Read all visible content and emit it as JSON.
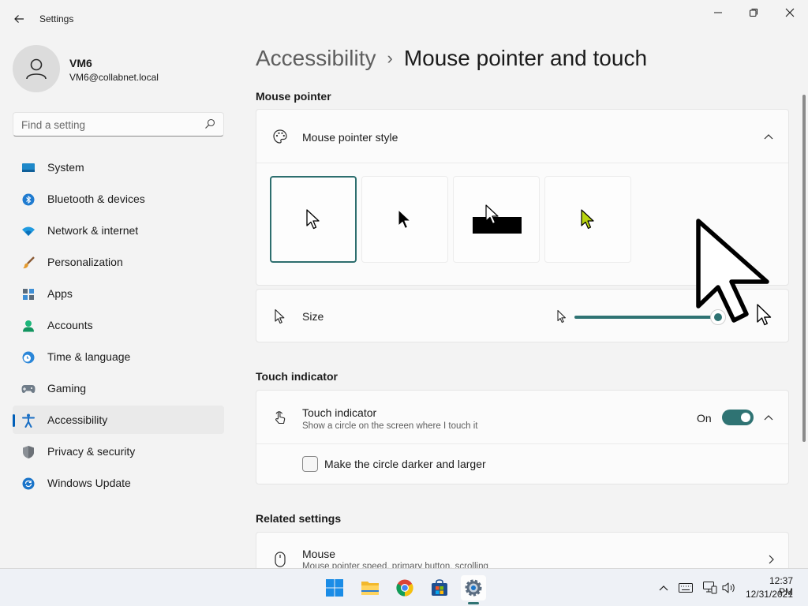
{
  "window": {
    "app_title": "Settings",
    "controls": {
      "minimize": "minimize-icon",
      "maximize": "restore-icon",
      "close": "close-icon"
    }
  },
  "user": {
    "name": "VM6",
    "email": "VM6@collabnet.local"
  },
  "search": {
    "placeholder": "Find a setting"
  },
  "sidebar": {
    "items": [
      {
        "label": "System",
        "icon": "system-icon",
        "active": false
      },
      {
        "label": "Bluetooth & devices",
        "icon": "bluetooth-icon",
        "active": false
      },
      {
        "label": "Network & internet",
        "icon": "network-icon",
        "active": false
      },
      {
        "label": "Personalization",
        "icon": "brush-icon",
        "active": false
      },
      {
        "label": "Apps",
        "icon": "apps-icon",
        "active": false
      },
      {
        "label": "Accounts",
        "icon": "accounts-icon",
        "active": false
      },
      {
        "label": "Time & language",
        "icon": "time-language-icon",
        "active": false
      },
      {
        "label": "Gaming",
        "icon": "gaming-icon",
        "active": false
      },
      {
        "label": "Accessibility",
        "icon": "accessibility-icon",
        "active": true
      },
      {
        "label": "Privacy & security",
        "icon": "shield-icon",
        "active": false
      },
      {
        "label": "Windows Update",
        "icon": "update-icon",
        "active": false
      }
    ]
  },
  "breadcrumb": {
    "parent": "Accessibility",
    "separator": "›",
    "current": "Mouse pointer and touch"
  },
  "mouse_pointer": {
    "section_title": "Mouse pointer",
    "style_label": "Mouse pointer style",
    "styles": [
      "white",
      "black",
      "inverted",
      "custom"
    ],
    "selected_style": "white",
    "custom_color": "#b8d410",
    "size_label": "Size",
    "size_value_fraction": 0.98
  },
  "touch": {
    "section_title": "Touch indicator",
    "label": "Touch indicator",
    "description": "Show a circle on the screen where I touch it",
    "state_label": "On",
    "enabled": true,
    "option_label": "Make the circle darker and larger",
    "option_checked": false
  },
  "related": {
    "section_title": "Related settings",
    "mouse_label": "Mouse",
    "mouse_description": "Mouse pointer speed, primary button, scrolling"
  },
  "colors": {
    "accent": "#2f7373",
    "selection_accent": "#005fb8",
    "background": "#f3f3f3",
    "card": "#fbfbfb"
  },
  "taskbar": {
    "apps": [
      "start-icon",
      "file-explorer-icon",
      "chrome-icon",
      "store-icon",
      "settings-icon"
    ],
    "time": "12:37 PM",
    "date": "12/31/2021"
  }
}
